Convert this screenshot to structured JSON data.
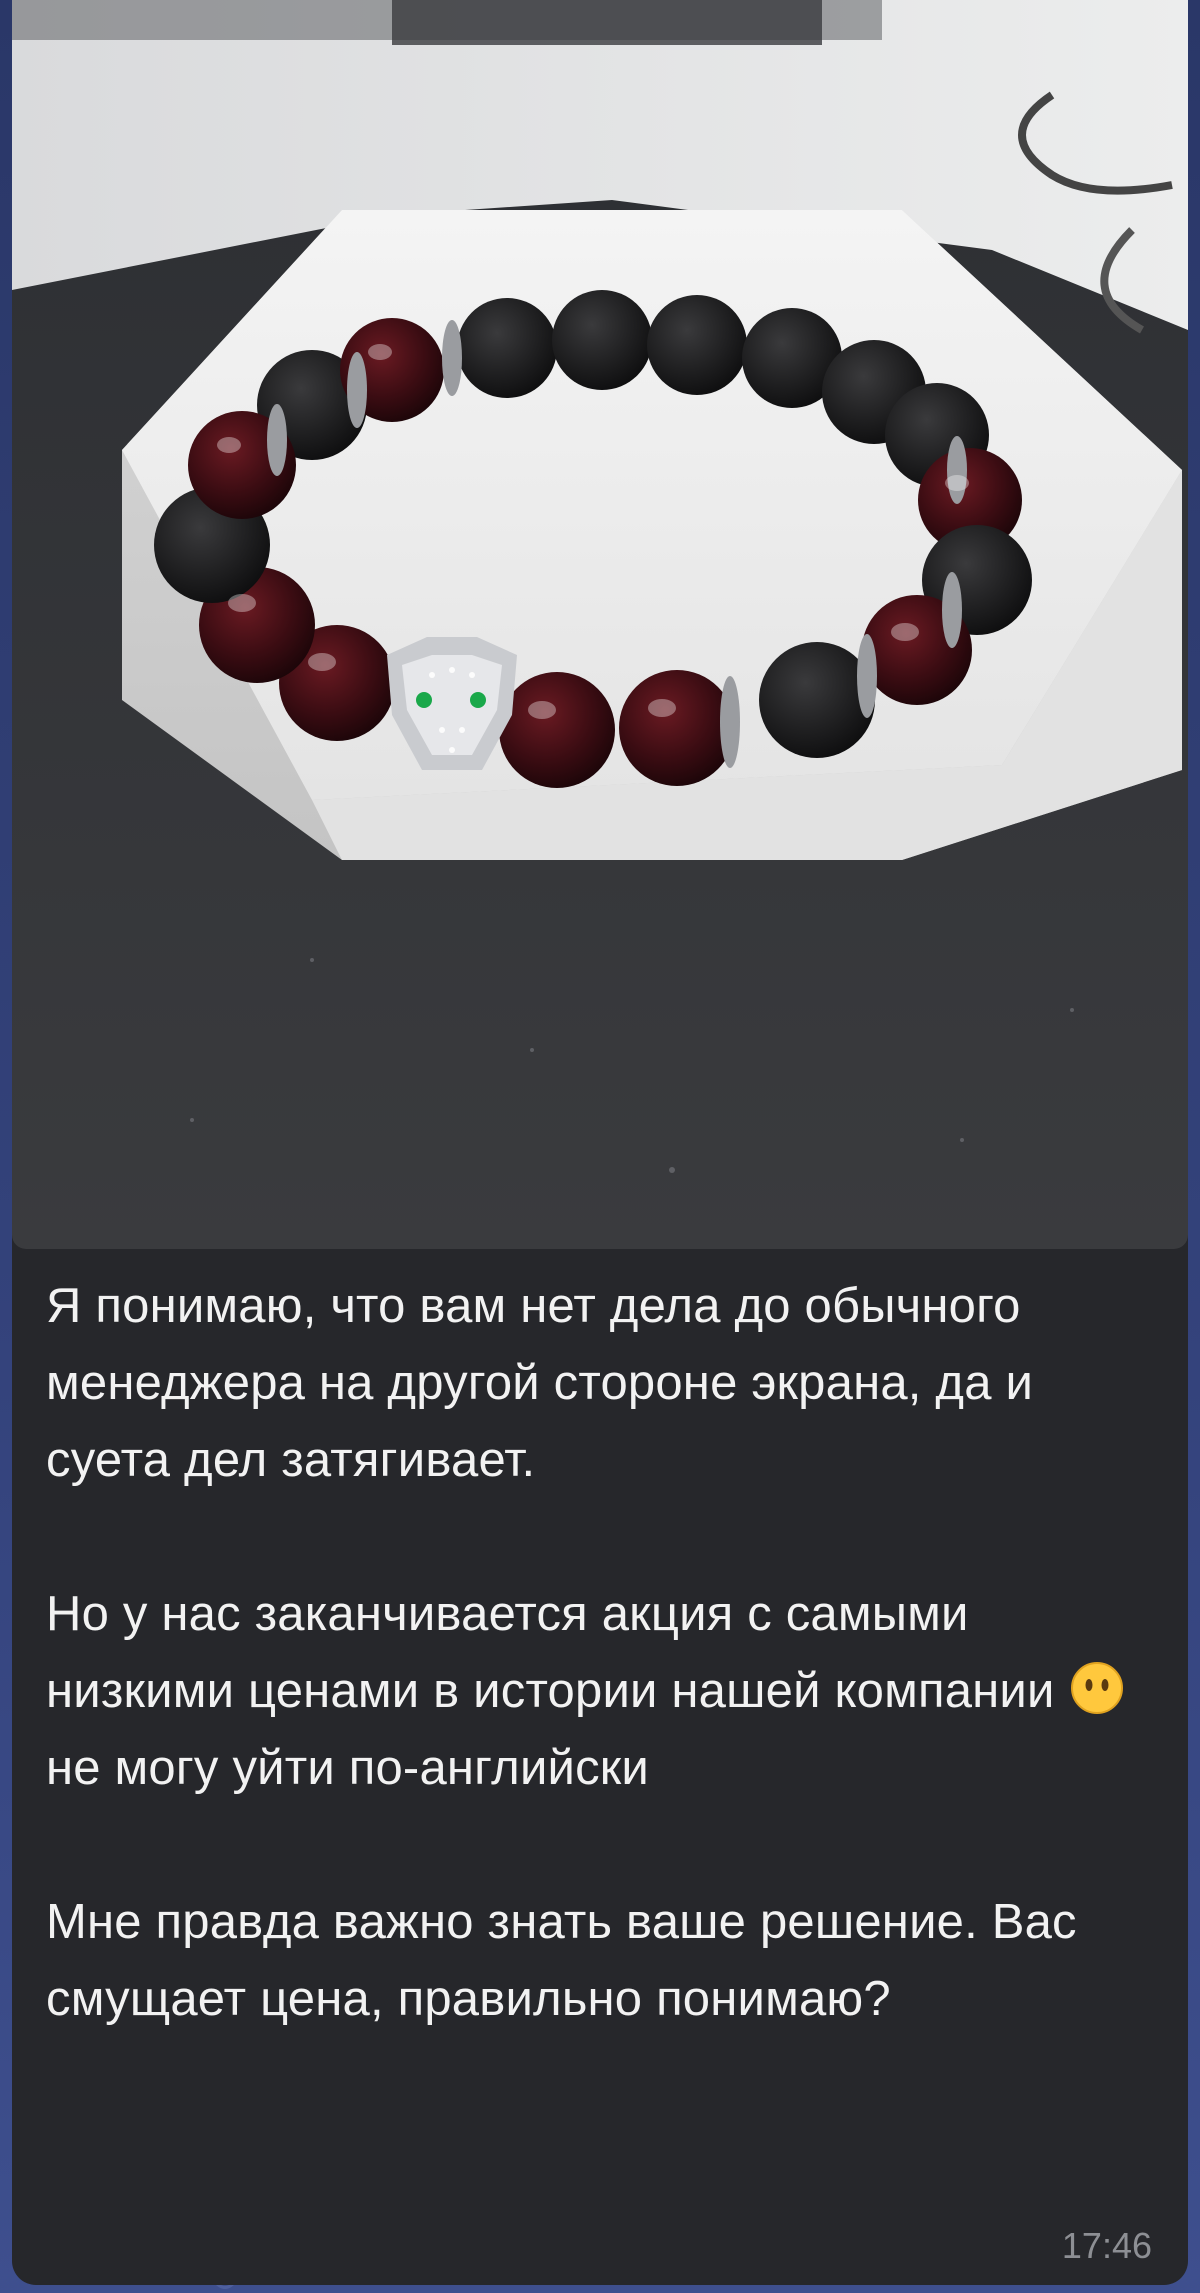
{
  "message": {
    "paragraph1": "Я понимаю, что вам нет дела до обычного менеджера на другой стороне экрана, да и суета дел затягивает.",
    "paragraph2a": "Но у нас заканчивается акция с самыми низкими ценами в истории нашей компании",
    "emoji": "face-without-mouth-emoji",
    "paragraph2b": "не могу уйти по-английски",
    "paragraph3": "Мне правда важно знать ваше решение. Вас смущает цена, правильно понимаю?",
    "time": "17:46"
  },
  "colors": {
    "bubble": "#26272b",
    "text": "#f2f2f2",
    "time": "#8d8f94",
    "wallpaper": "#2c3a6e"
  }
}
